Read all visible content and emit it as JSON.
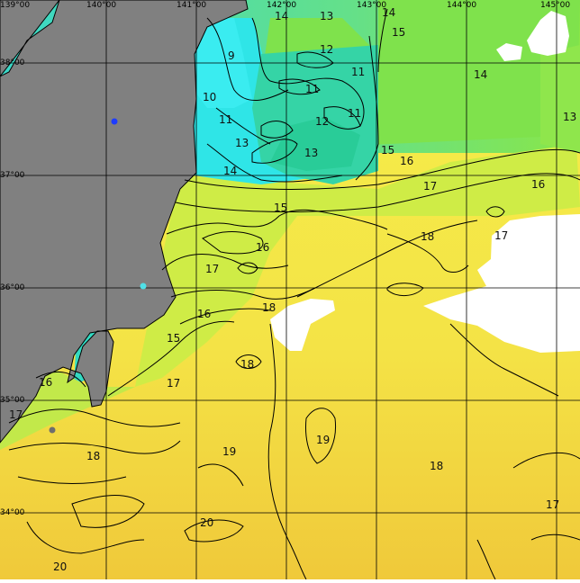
{
  "map": {
    "lon_labels": [
      "139°00",
      "140°00",
      "141°00",
      "142°00",
      "143°00",
      "144°00",
      "145°00"
    ],
    "lat_labels": [
      "38°00",
      "37°00",
      "36°00",
      "35°00",
      "34°00"
    ],
    "isotherm_labels": [
      "14",
      "13",
      "14",
      "15",
      "9",
      "12",
      "11",
      "11",
      "14",
      "10",
      "11",
      "12",
      "11",
      "13",
      "13",
      "13",
      "14",
      "15",
      "16",
      "17",
      "16",
      "15",
      "18",
      "17",
      "16",
      "17",
      "16",
      "18",
      "15",
      "18",
      "17",
      "16",
      "17",
      "18",
      "19",
      "19",
      "18",
      "17",
      "20",
      "20"
    ],
    "colors": {
      "land": "#808080",
      "missing_data": "#ffffff",
      "temp_9": "#39e6ee",
      "temp_12": "#2cd6a8",
      "temp_14": "#84e84a",
      "temp_16": "#d9ec43",
      "temp_18": "#f4ee47",
      "temp_20": "#f2cd3a",
      "grid": "#000000",
      "contour": "#000000",
      "station_blue": "#1e3cff",
      "station_cyan": "#4fe0e8",
      "station_gray": "#6e6e6e"
    }
  }
}
